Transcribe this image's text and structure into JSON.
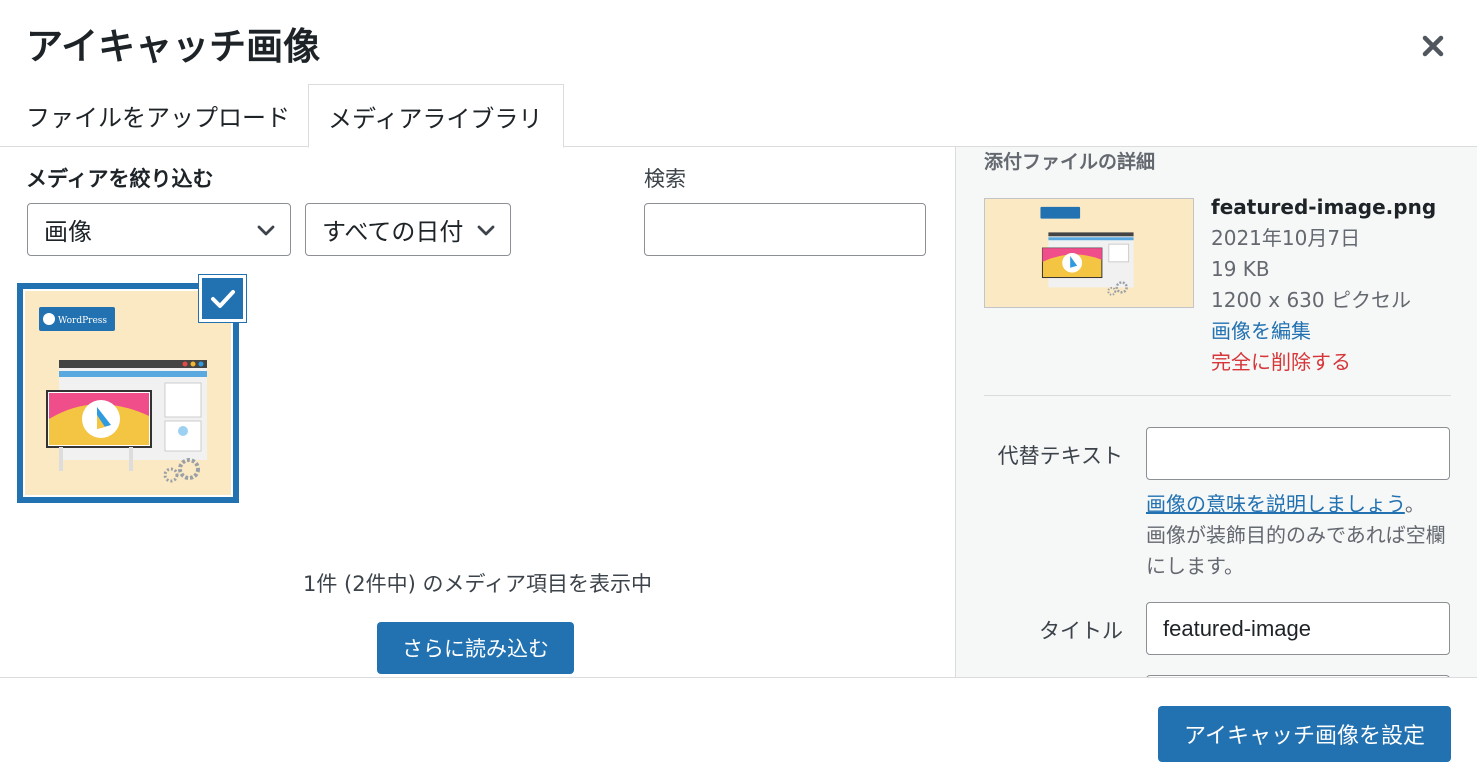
{
  "modal": {
    "title": "アイキャッチ画像",
    "close_icon": "close-icon"
  },
  "tabs": [
    {
      "label": "ファイルをアップロード",
      "active": false
    },
    {
      "label": "メディアライブラリ",
      "active": true
    }
  ],
  "filters": {
    "label": "メディアを絞り込む",
    "type_select": "画像",
    "date_select": "すべての日付",
    "search_label": "検索",
    "search_value": ""
  },
  "media": {
    "items": [
      {
        "name": "featured-image",
        "selected": true,
        "logo_text": "WordPress"
      }
    ],
    "count_text": "1件 (2件中) のメディア項目を表示中",
    "load_more": "さらに読み込む"
  },
  "details": {
    "heading": "添付ファイルの詳細",
    "filename": "featured-image.png",
    "date": "2021年10月7日",
    "size": "19 KB",
    "dimensions": "1200 x 630 ピクセル",
    "edit_link": "画像を編集",
    "delete_link": "完全に削除する",
    "alt_label": "代替テキスト",
    "alt_value": "",
    "alt_help_link": "画像の意味を説明しましょう",
    "alt_help_period": "。",
    "alt_help_text": "画像が装飾目的のみであれば空欄にします。",
    "title_label": "タイトル",
    "title_value": "featured-image"
  },
  "footer": {
    "set_button": "アイキャッチ画像を設定"
  },
  "colors": {
    "accent": "#2271b1",
    "danger": "#d63638",
    "thumb_bg": "#fbe9c4"
  }
}
